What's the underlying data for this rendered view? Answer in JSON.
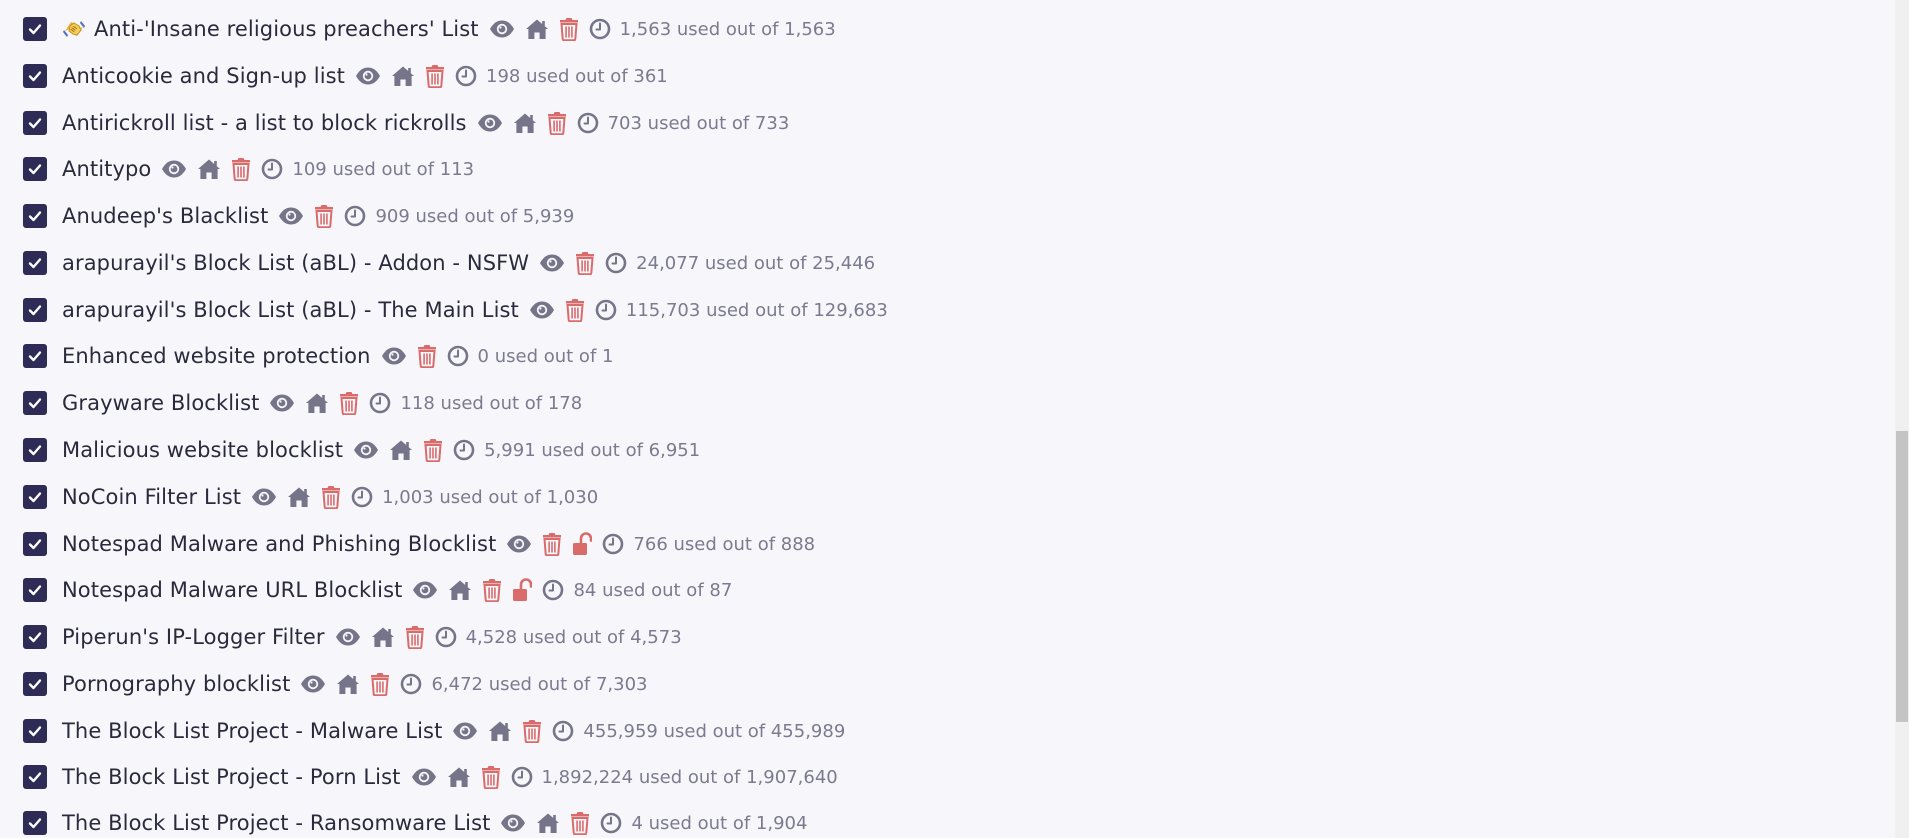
{
  "blocklists": [
    {
      "name": "Anti-'Insane religious preachers' List",
      "emoji": true,
      "home": true,
      "unlocked": false,
      "usage": "1,563 used out of 1,563"
    },
    {
      "name": "Anticookie and Sign-up list",
      "emoji": false,
      "home": true,
      "unlocked": false,
      "usage": "198 used out of 361"
    },
    {
      "name": "Antirickroll list - a list to block rickrolls",
      "emoji": false,
      "home": true,
      "unlocked": false,
      "usage": "703 used out of 733"
    },
    {
      "name": "Antitypo",
      "emoji": false,
      "home": true,
      "unlocked": false,
      "usage": "109 used out of 113"
    },
    {
      "name": "Anudeep's Blacklist",
      "emoji": false,
      "home": false,
      "unlocked": false,
      "usage": "909 used out of 5,939"
    },
    {
      "name": "arapurayil's Block List (aBL) - Addon - NSFW",
      "emoji": false,
      "home": false,
      "unlocked": false,
      "usage": "24,077 used out of 25,446"
    },
    {
      "name": "arapurayil's Block List (aBL) - The Main List",
      "emoji": false,
      "home": false,
      "unlocked": false,
      "usage": "115,703 used out of 129,683"
    },
    {
      "name": "Enhanced website protection",
      "emoji": false,
      "home": false,
      "unlocked": false,
      "usage": "0 used out of 1"
    },
    {
      "name": "Grayware Blocklist",
      "emoji": false,
      "home": true,
      "unlocked": false,
      "usage": "118 used out of 178"
    },
    {
      "name": "Malicious website blocklist",
      "emoji": false,
      "home": true,
      "unlocked": false,
      "usage": "5,991 used out of 6,951"
    },
    {
      "name": "NoCoin Filter List",
      "emoji": false,
      "home": true,
      "unlocked": false,
      "usage": "1,003 used out of 1,030"
    },
    {
      "name": "Notespad Malware and Phishing Blocklist",
      "emoji": false,
      "home": false,
      "unlocked": true,
      "usage": "766 used out of 888"
    },
    {
      "name": "Notespad Malware URL Blocklist",
      "emoji": false,
      "home": true,
      "unlocked": true,
      "usage": "84 used out of 87"
    },
    {
      "name": "Piperun's IP-Logger Filter",
      "emoji": false,
      "home": true,
      "unlocked": false,
      "usage": "4,528 used out of 4,573"
    },
    {
      "name": "Pornography blocklist",
      "emoji": false,
      "home": true,
      "unlocked": false,
      "usage": "6,472 used out of 7,303"
    },
    {
      "name": "The Block List Project - Malware List",
      "emoji": false,
      "home": true,
      "unlocked": false,
      "usage": "455,959 used out of 455,989"
    },
    {
      "name": "The Block List Project - Porn List",
      "emoji": false,
      "home": true,
      "unlocked": false,
      "usage": "1,892,224 used out of 1,907,640"
    },
    {
      "name": "The Block List Project - Ransomware List",
      "emoji": false,
      "home": true,
      "unlocked": false,
      "usage": "4 used out of 1,904"
    }
  ],
  "icons": {
    "checkbox": "checkmark-icon",
    "view": "eye-icon",
    "homepage": "home-icon",
    "delete": "trash-icon",
    "unlocked": "unlock-icon",
    "updated": "clock-icon",
    "emoji": "handshake-emoji-icon"
  },
  "colors": {
    "checkbox_bg": "#2f2b57",
    "text": "#2a2a3c",
    "icon_gray": "#757489",
    "danger": "#d96b6b",
    "muted": "#7b7a8e",
    "page_bg": "#f7f7fb"
  }
}
